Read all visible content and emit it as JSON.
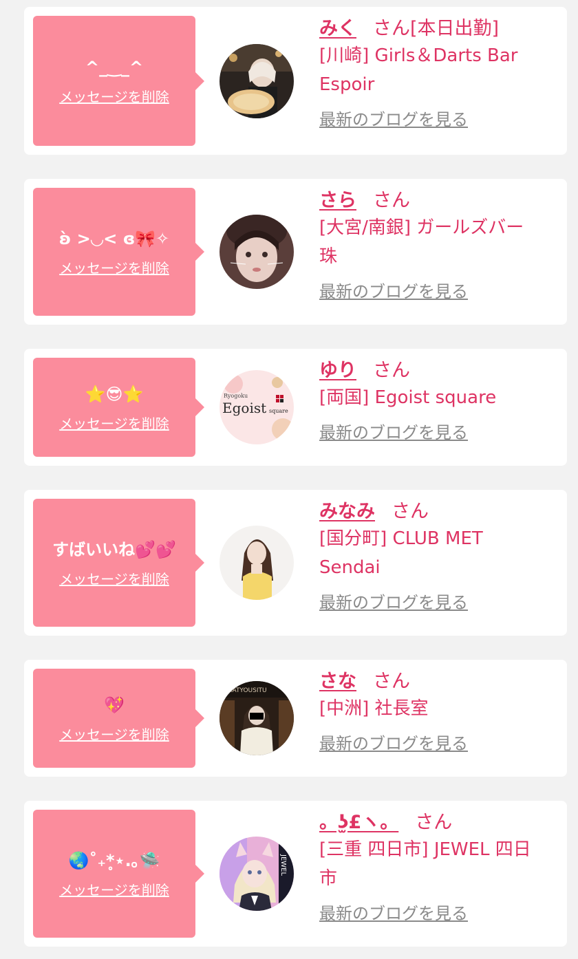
{
  "cards": [
    {
      "message": "^_‿_^",
      "delete_label": "メッセージを削除",
      "name": "みく",
      "honorific": "さん",
      "status": "[本日出勤]",
      "shop_line1": "[川崎] Girls＆Darts Bar",
      "shop_line2": "Espoir",
      "blog_label": "最新のブログを見る"
    },
    {
      "message": "ʚ̀ >◡< ɞ🎀✧",
      "delete_label": "メッセージを削除",
      "name": "さら",
      "honorific": "さん",
      "status": "",
      "shop_line1": "[大宮/南銀] ガールズバー",
      "shop_line2": "珠",
      "blog_label": "最新のブログを見る"
    },
    {
      "message": "⭐😎⭐",
      "delete_label": "メッセージを削除",
      "name": "ゆり",
      "honorific": "さん",
      "status": "",
      "shop_line1": "[両国] Egoist square",
      "shop_line2": "",
      "blog_label": "最新のブログを見る",
      "avatar_logo": "Egoist",
      "avatar_logo_sub": "Ryogoku",
      "avatar_logo_small": "square"
    },
    {
      "message": "すばいいね💕💕",
      "delete_label": "メッセージを削除",
      "name": "みなみ",
      "honorific": "さん",
      "status": "",
      "shop_line1": "[国分町] CLUB MET",
      "shop_line2": "Sendai",
      "blog_label": "最新のブログを見る"
    },
    {
      "message": "💖",
      "delete_label": "メッセージを削除",
      "name": "さな",
      "honorific": "さん",
      "status": "",
      "shop_line1": "[中洲] 社長室",
      "shop_line2": "",
      "blog_label": "最新のブログを見る",
      "avatar_logo": "SHATYOUSITU"
    },
    {
      "message": "🌏˚₊*̥⋆.｡🛸",
      "delete_label": "メッセージを削除",
      "name": "。ʖ̫£ヽ。",
      "honorific": "さん",
      "status": "",
      "shop_line1": "[三重 四日市] JEWEL 四日",
      "shop_line2": "市",
      "blog_label": "最新のブログを見る",
      "avatar_logo": "JEWEL"
    }
  ],
  "colors": {
    "accent": "#de3363",
    "bubble": "#fb8c9c",
    "link_gray": "#8a8a8a",
    "page_bg": "#f2f2f2"
  }
}
